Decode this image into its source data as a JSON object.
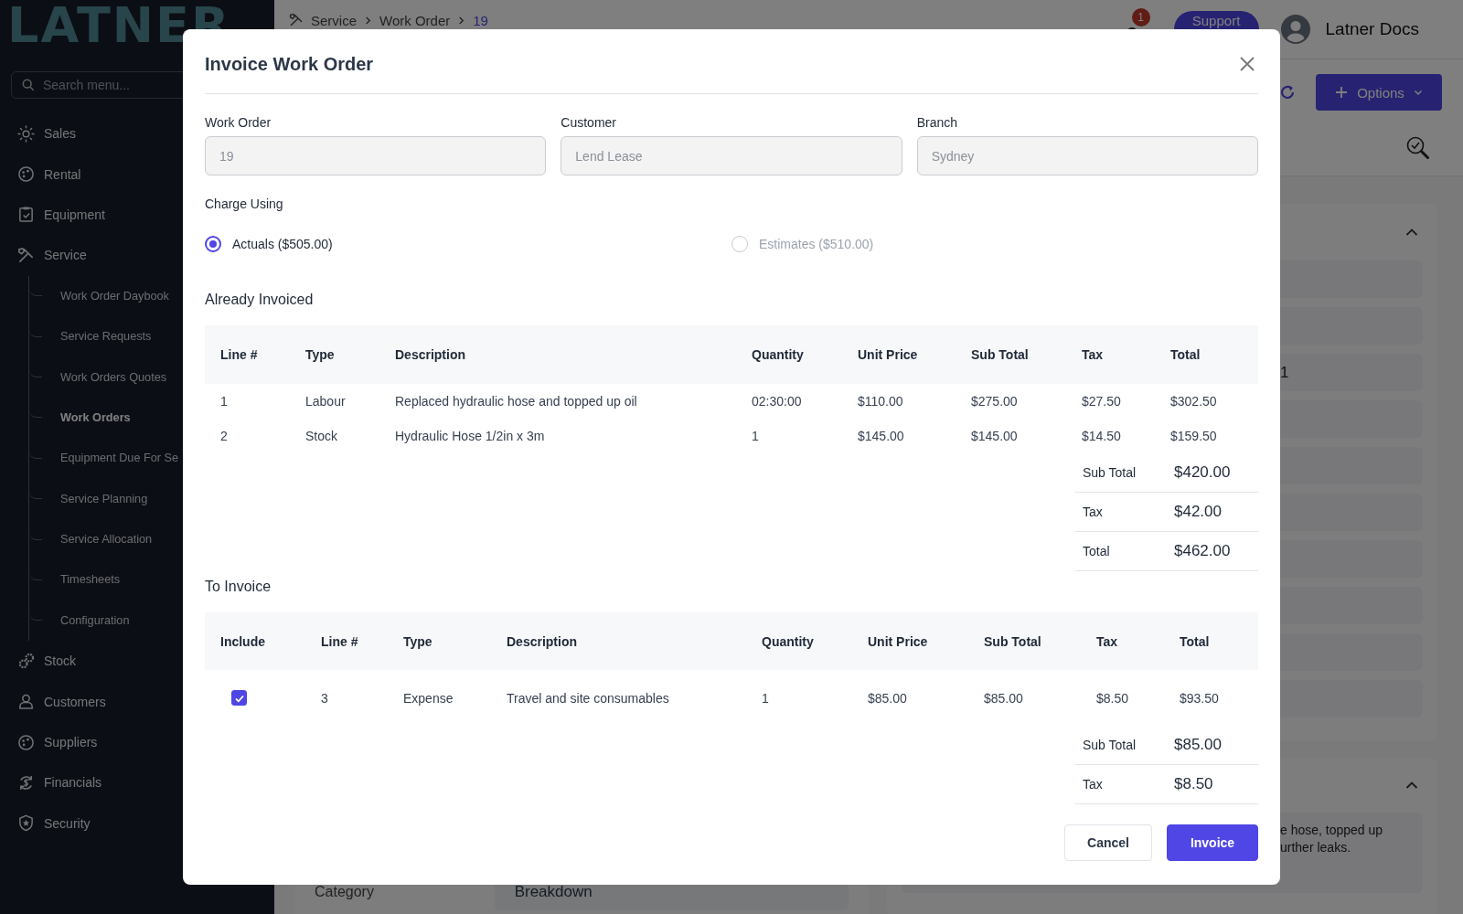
{
  "sidebar": {
    "logo": "LATNER",
    "search": {
      "placeholder": "Search menu..."
    },
    "items": [
      {
        "label": "Sales"
      },
      {
        "label": "Rental"
      },
      {
        "label": "Equipment"
      },
      {
        "label": "Service",
        "children": [
          {
            "label": "Work Order Daybook",
            "selected": false
          },
          {
            "label": "Service Requests",
            "selected": false
          },
          {
            "label": "Work Orders Quotes",
            "selected": false
          },
          {
            "label": "Work Orders",
            "selected": true
          },
          {
            "label": "Equipment Due For Se",
            "selected": false
          },
          {
            "label": "Service Planning",
            "selected": false
          },
          {
            "label": "Service Allocation",
            "selected": false
          },
          {
            "label": "Timesheets",
            "selected": false
          },
          {
            "label": "Configuration",
            "selected": false
          }
        ]
      },
      {
        "label": "Stock"
      },
      {
        "label": "Customers"
      },
      {
        "label": "Suppliers"
      },
      {
        "label": "Financials"
      },
      {
        "label": "Security"
      }
    ]
  },
  "topbar": {
    "breadcrumb": [
      "Service",
      "Work Order",
      "19"
    ],
    "notification_count": "1",
    "support_button": "Support",
    "user_name": "Latner Docs"
  },
  "toolbar": {
    "options_button": "Options"
  },
  "detail_card": {
    "field_value": "1"
  },
  "notes_card": {
    "lines": [
      "e hose, topped up",
      "urther leaks."
    ]
  },
  "details": {
    "label": "Category",
    "value": "Breakdown"
  },
  "dialog": {
    "title": "Invoice Work Order",
    "fields": [
      {
        "label": "Work Order",
        "value": "19",
        "disabled": true
      },
      {
        "label": "Customer",
        "value": "Lend Lease",
        "disabled": true
      },
      {
        "label": "Branch",
        "value": "Sydney",
        "disabled": true
      }
    ],
    "charge_using": {
      "label": "Charge Using",
      "options": [
        {
          "label": "Actuals ($505.00)",
          "selected": true,
          "disabled": false
        },
        {
          "label": "Estimates ($510.00)",
          "selected": false,
          "disabled": true
        }
      ]
    },
    "already_invoiced": {
      "title": "Already Invoiced",
      "columns": [
        "Line #",
        "Type",
        "Description",
        "Quantity",
        "Unit Price",
        "Sub Total",
        "Tax",
        "Total"
      ],
      "rows": [
        [
          "1",
          "Labour",
          "Replaced hydraulic hose and topped up oil",
          "02:30:00",
          "$110.00",
          "$275.00",
          "$27.50",
          "$302.50"
        ],
        [
          "2",
          "Stock",
          "Hydraulic Hose 1/2in x 3m",
          "1",
          "$145.00",
          "$145.00",
          "$14.50",
          "$159.50"
        ]
      ],
      "totals": [
        {
          "label": "Sub Total",
          "value": "$420.00"
        },
        {
          "label": "Tax",
          "value": "$42.00"
        },
        {
          "label": "Total",
          "value": "$462.00"
        }
      ]
    },
    "to_invoice": {
      "title": "To Invoice",
      "include_column": "Include",
      "columns": [
        "Line #",
        "Type",
        "Description",
        "Quantity",
        "Unit Price",
        "Sub Total",
        "Tax",
        "Total"
      ],
      "rows": [
        {
          "include": true,
          "cells": [
            "3",
            "Expense",
            "Travel and site consumables",
            "1",
            "$85.00",
            "$85.00",
            "$8.50",
            "$93.50"
          ]
        }
      ],
      "totals": [
        {
          "label": "Sub Total",
          "value": "$85.00"
        },
        {
          "label": "Tax",
          "value": "$8.50"
        }
      ]
    },
    "buttons": [
      {
        "label": "Cancel",
        "kind": "secondary"
      },
      {
        "label": "Invoice",
        "kind": "primary"
      }
    ]
  }
}
